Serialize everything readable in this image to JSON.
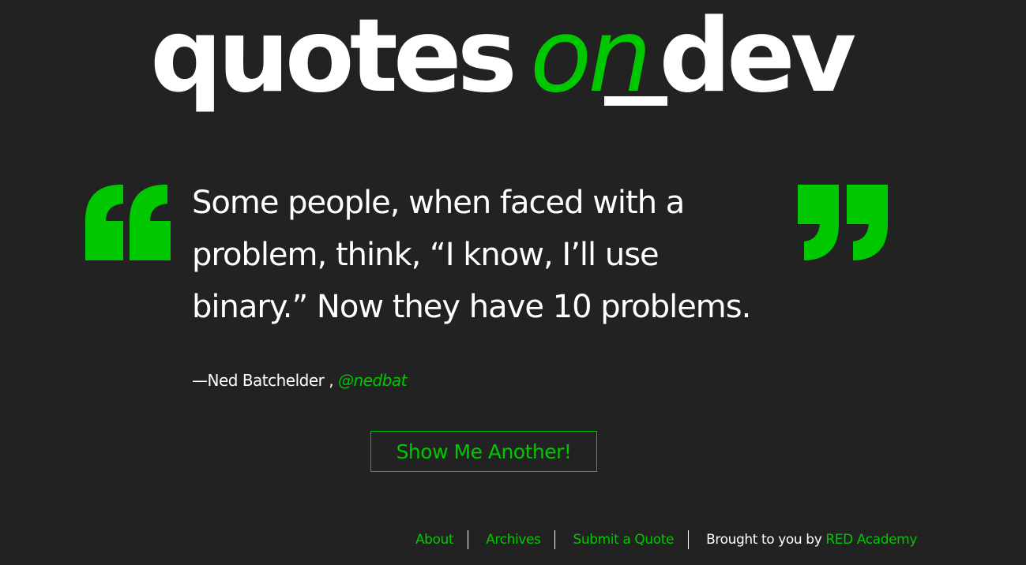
{
  "logo": {
    "word1": "quotes",
    "word2": "on",
    "word3": "dev"
  },
  "quote": {
    "text": "Some people, when faced with a problem, think, “I know, I’ll use binary.” Now they have 10 problems.",
    "author_prefix": "—Ned Batchelder ,",
    "source": "@nedbat"
  },
  "button": {
    "label": "Show Me Another!"
  },
  "footer": {
    "links": [
      "About",
      "Archives",
      "Submit a Quote"
    ],
    "credit_text": "Brought to you by",
    "credit_link": "RED Academy"
  },
  "colors": {
    "background": "#222222",
    "accent": "#00c800",
    "text": "#ffffff"
  }
}
